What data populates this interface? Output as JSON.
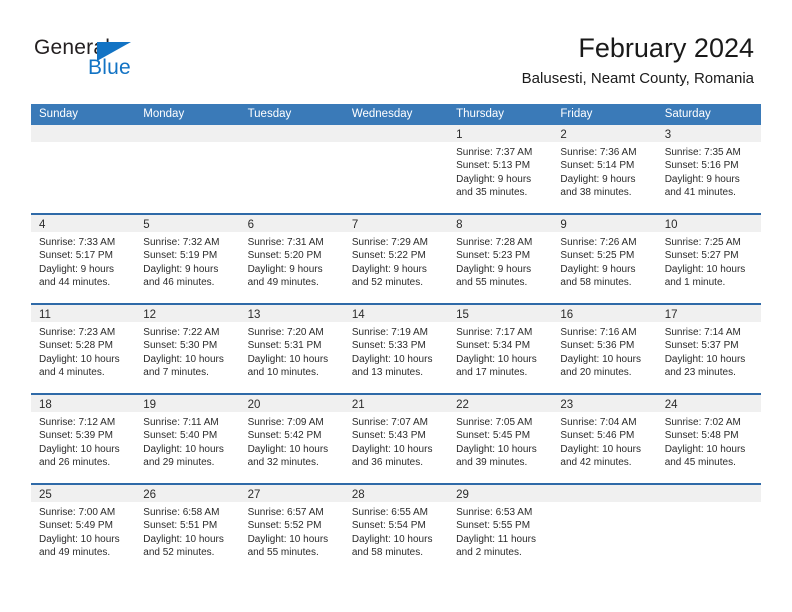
{
  "brand": {
    "name_part1": "General",
    "name_part2": "Blue"
  },
  "header": {
    "title": "February 2024",
    "subtitle": "Balusesti, Neamt County, Romania"
  },
  "colors": {
    "header_blue": "#3a7ab8",
    "separator_blue": "#2f6aa8",
    "daynum_strip": "#f0f0f0",
    "logo_blue": "#1273c4"
  },
  "weekdays": [
    "Sunday",
    "Monday",
    "Tuesday",
    "Wednesday",
    "Thursday",
    "Friday",
    "Saturday"
  ],
  "weeks": [
    [
      {
        "day": "",
        "lines": []
      },
      {
        "day": "",
        "lines": []
      },
      {
        "day": "",
        "lines": []
      },
      {
        "day": "",
        "lines": []
      },
      {
        "day": "1",
        "lines": [
          "Sunrise: 7:37 AM",
          "Sunset: 5:13 PM",
          "Daylight: 9 hours",
          "and 35 minutes."
        ]
      },
      {
        "day": "2",
        "lines": [
          "Sunrise: 7:36 AM",
          "Sunset: 5:14 PM",
          "Daylight: 9 hours",
          "and 38 minutes."
        ]
      },
      {
        "day": "3",
        "lines": [
          "Sunrise: 7:35 AM",
          "Sunset: 5:16 PM",
          "Daylight: 9 hours",
          "and 41 minutes."
        ]
      }
    ],
    [
      {
        "day": "4",
        "lines": [
          "Sunrise: 7:33 AM",
          "Sunset: 5:17 PM",
          "Daylight: 9 hours",
          "and 44 minutes."
        ]
      },
      {
        "day": "5",
        "lines": [
          "Sunrise: 7:32 AM",
          "Sunset: 5:19 PM",
          "Daylight: 9 hours",
          "and 46 minutes."
        ]
      },
      {
        "day": "6",
        "lines": [
          "Sunrise: 7:31 AM",
          "Sunset: 5:20 PM",
          "Daylight: 9 hours",
          "and 49 minutes."
        ]
      },
      {
        "day": "7",
        "lines": [
          "Sunrise: 7:29 AM",
          "Sunset: 5:22 PM",
          "Daylight: 9 hours",
          "and 52 minutes."
        ]
      },
      {
        "day": "8",
        "lines": [
          "Sunrise: 7:28 AM",
          "Sunset: 5:23 PM",
          "Daylight: 9 hours",
          "and 55 minutes."
        ]
      },
      {
        "day": "9",
        "lines": [
          "Sunrise: 7:26 AM",
          "Sunset: 5:25 PM",
          "Daylight: 9 hours",
          "and 58 minutes."
        ]
      },
      {
        "day": "10",
        "lines": [
          "Sunrise: 7:25 AM",
          "Sunset: 5:27 PM",
          "Daylight: 10 hours",
          "and 1 minute."
        ]
      }
    ],
    [
      {
        "day": "11",
        "lines": [
          "Sunrise: 7:23 AM",
          "Sunset: 5:28 PM",
          "Daylight: 10 hours",
          "and 4 minutes."
        ]
      },
      {
        "day": "12",
        "lines": [
          "Sunrise: 7:22 AM",
          "Sunset: 5:30 PM",
          "Daylight: 10 hours",
          "and 7 minutes."
        ]
      },
      {
        "day": "13",
        "lines": [
          "Sunrise: 7:20 AM",
          "Sunset: 5:31 PM",
          "Daylight: 10 hours",
          "and 10 minutes."
        ]
      },
      {
        "day": "14",
        "lines": [
          "Sunrise: 7:19 AM",
          "Sunset: 5:33 PM",
          "Daylight: 10 hours",
          "and 13 minutes."
        ]
      },
      {
        "day": "15",
        "lines": [
          "Sunrise: 7:17 AM",
          "Sunset: 5:34 PM",
          "Daylight: 10 hours",
          "and 17 minutes."
        ]
      },
      {
        "day": "16",
        "lines": [
          "Sunrise: 7:16 AM",
          "Sunset: 5:36 PM",
          "Daylight: 10 hours",
          "and 20 minutes."
        ]
      },
      {
        "day": "17",
        "lines": [
          "Sunrise: 7:14 AM",
          "Sunset: 5:37 PM",
          "Daylight: 10 hours",
          "and 23 minutes."
        ]
      }
    ],
    [
      {
        "day": "18",
        "lines": [
          "Sunrise: 7:12 AM",
          "Sunset: 5:39 PM",
          "Daylight: 10 hours",
          "and 26 minutes."
        ]
      },
      {
        "day": "19",
        "lines": [
          "Sunrise: 7:11 AM",
          "Sunset: 5:40 PM",
          "Daylight: 10 hours",
          "and 29 minutes."
        ]
      },
      {
        "day": "20",
        "lines": [
          "Sunrise: 7:09 AM",
          "Sunset: 5:42 PM",
          "Daylight: 10 hours",
          "and 32 minutes."
        ]
      },
      {
        "day": "21",
        "lines": [
          "Sunrise: 7:07 AM",
          "Sunset: 5:43 PM",
          "Daylight: 10 hours",
          "and 36 minutes."
        ]
      },
      {
        "day": "22",
        "lines": [
          "Sunrise: 7:05 AM",
          "Sunset: 5:45 PM",
          "Daylight: 10 hours",
          "and 39 minutes."
        ]
      },
      {
        "day": "23",
        "lines": [
          "Sunrise: 7:04 AM",
          "Sunset: 5:46 PM",
          "Daylight: 10 hours",
          "and 42 minutes."
        ]
      },
      {
        "day": "24",
        "lines": [
          "Sunrise: 7:02 AM",
          "Sunset: 5:48 PM",
          "Daylight: 10 hours",
          "and 45 minutes."
        ]
      }
    ],
    [
      {
        "day": "25",
        "lines": [
          "Sunrise: 7:00 AM",
          "Sunset: 5:49 PM",
          "Daylight: 10 hours",
          "and 49 minutes."
        ]
      },
      {
        "day": "26",
        "lines": [
          "Sunrise: 6:58 AM",
          "Sunset: 5:51 PM",
          "Daylight: 10 hours",
          "and 52 minutes."
        ]
      },
      {
        "day": "27",
        "lines": [
          "Sunrise: 6:57 AM",
          "Sunset: 5:52 PM",
          "Daylight: 10 hours",
          "and 55 minutes."
        ]
      },
      {
        "day": "28",
        "lines": [
          "Sunrise: 6:55 AM",
          "Sunset: 5:54 PM",
          "Daylight: 10 hours",
          "and 58 minutes."
        ]
      },
      {
        "day": "29",
        "lines": [
          "Sunrise: 6:53 AM",
          "Sunset: 5:55 PM",
          "Daylight: 11 hours",
          "and 2 minutes."
        ]
      },
      {
        "day": "",
        "lines": []
      },
      {
        "day": "",
        "lines": []
      }
    ]
  ]
}
